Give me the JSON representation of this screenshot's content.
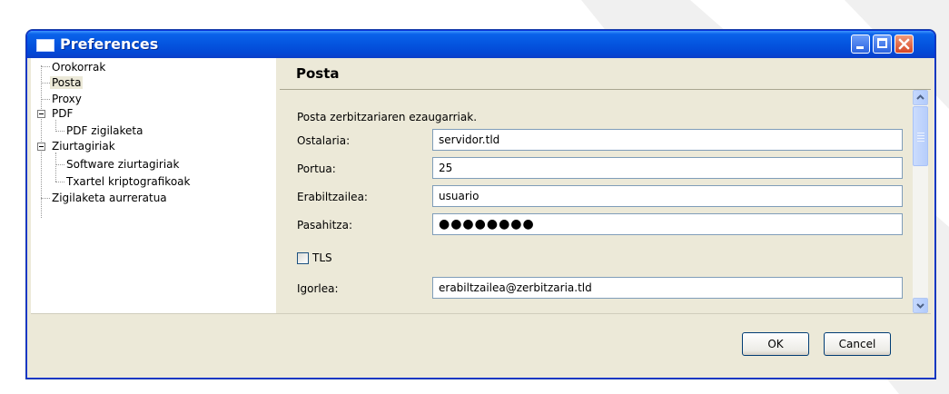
{
  "window": {
    "title": "Preferences"
  },
  "tree": {
    "items": [
      {
        "label": "Orokorrak"
      },
      {
        "label": "Posta"
      },
      {
        "label": "Proxy"
      },
      {
        "label": "PDF"
      },
      {
        "label": "PDF zigilaketa"
      },
      {
        "label": "Ziurtagiriak"
      },
      {
        "label": "Software ziurtagiriak"
      },
      {
        "label": "Txartel kriptografikoak"
      },
      {
        "label": "Zigilaketa aurreratua"
      }
    ],
    "selected": "Posta"
  },
  "panel": {
    "title": "Posta",
    "description": "Posta zerbitzariaren ezaugarriak.",
    "fields": [
      {
        "label": "Ostalaria:",
        "value": "servidor.tld"
      },
      {
        "label": "Portua:",
        "value": "25"
      },
      {
        "label": "Erabiltzailea:",
        "value": "usuario"
      },
      {
        "label": "Pasahitza:",
        "value": "●●●●●●●●"
      },
      {
        "label": "Igorlea:",
        "value": "erabiltzailea@zerbitzaria.tld"
      }
    ],
    "tls_label": "TLS",
    "tls_checked": false
  },
  "buttons": {
    "ok": "OK",
    "cancel": "Cancel"
  },
  "colors": {
    "titlebar": "#0454df",
    "close_button": "#d64625",
    "dialog_bg": "#ece9d8"
  }
}
